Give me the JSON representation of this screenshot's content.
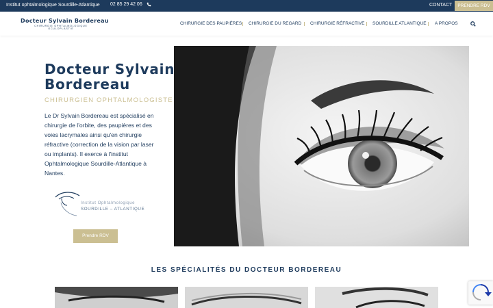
{
  "topbar": {
    "institute": "Institut ophtalmologique Sourdille-Atlantique",
    "phone": "02 85 29 42 06",
    "contact": "CONTACT",
    "rdv": "PRENDRE RDV"
  },
  "logo": {
    "name": "Docteur Sylvain Bordereau",
    "line1": "CHIRURGIE OPHTALMOLOGIQUE",
    "line2": "OCULOPLASTIE"
  },
  "nav": {
    "items": [
      {
        "label": "CHIRURGIE DES PAUPIÈRES"
      },
      {
        "label": "CHIRURGIE DU REGARD"
      },
      {
        "label": "CHIRURGIE RÉFRACTIVE"
      },
      {
        "label": "SOURDILLE ATLANTIQUE"
      },
      {
        "label": "A PROPOS"
      }
    ]
  },
  "hero": {
    "title_line1": "Docteur Sylvain",
    "title_line2": "Bordereau",
    "subtitle": "CHIRURGIEN OPHTALMOLOGISTE",
    "description": "Le Dr Sylvain Bordereau est spécialisé en chirurgie de l'orbite, des paupières et des voies lacrymales ainsi qu'en chirurgie réfractive (correction de la vision par laser ou implants). Il exerce à l'institut Ophtalmologique Sourdille-Atlantique à Nantes.",
    "institute_logo_line1": "Institut Ophtalmologique",
    "institute_logo_line2": "SOURDILLE – ATLANTIQUE",
    "button": "Prendre RDV"
  },
  "specialties": {
    "title": "LES SPÉCIALITÉS DU DOCTEUR BORDEREAU"
  },
  "colors": {
    "navy": "#1d3a5c",
    "gold": "#cbbf92"
  },
  "icons": [
    "phone-icon",
    "search-icon",
    "recaptcha-icon"
  ]
}
